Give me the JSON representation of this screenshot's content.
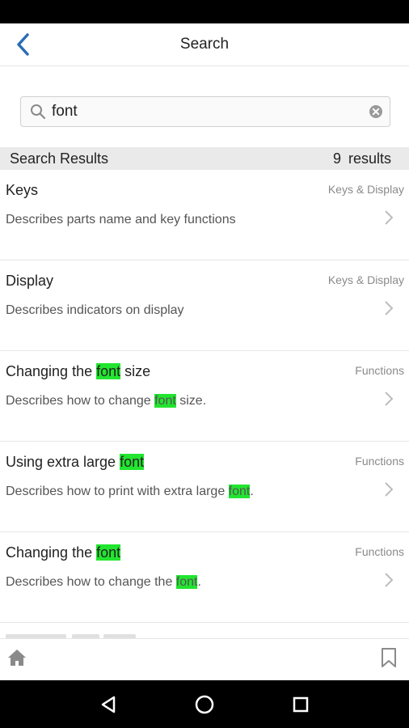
{
  "header": {
    "title": "Search"
  },
  "search": {
    "value": "font",
    "placeholder": ""
  },
  "results_header": {
    "label": "Search Results",
    "count": "9",
    "count_suffix": "results"
  },
  "results": [
    {
      "title": "Keys",
      "category": "Keys & Display",
      "description": "Describes parts name and key functions"
    },
    {
      "title": "Display",
      "category": "Keys & Display",
      "description": "Describes indicators on display"
    },
    {
      "title_before": "Changing the ",
      "title_highlight": "font",
      "title_after": " size",
      "category": "Functions",
      "desc_before": "Describes how to change ",
      "desc_highlight": "font",
      "desc_after": " size."
    },
    {
      "title_before": "Using extra large ",
      "title_highlight": "font",
      "title_after": "",
      "category": "Functions",
      "desc_before": "Describes how to print with extra large ",
      "desc_highlight": "font",
      "desc_after": "."
    },
    {
      "title_before": "Changing the ",
      "title_highlight": "font",
      "title_after": "",
      "category": "Functions",
      "desc_before": "Describes how to change the ",
      "desc_highlight": "font",
      "desc_after": "."
    }
  ],
  "colors": {
    "highlight": "#22e52f",
    "accent": "#2a6db5"
  },
  "icons": {
    "back": "chevron-left-icon",
    "search": "search-icon",
    "clear": "clear-icon",
    "home": "home-icon",
    "bookmark": "bookmark-icon"
  }
}
